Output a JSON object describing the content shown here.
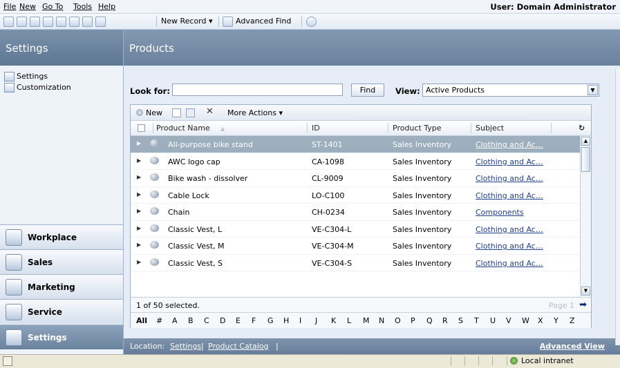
{
  "menu": {
    "items": [
      "File",
      "New",
      "Go To",
      "Tools",
      "Help"
    ],
    "user": "User: Domain Administrator"
  },
  "toolbar": {
    "new_record": "New Record ▾",
    "advanced_find": "Advanced Find"
  },
  "leftnav": {
    "title": "Settings",
    "items": [
      "Settings",
      "Customization"
    ],
    "wunderbar": [
      "Workplace",
      "Sales",
      "Marketing",
      "Service",
      "Settings"
    ]
  },
  "main": {
    "title": "Products",
    "lookfor_label": "Look for:",
    "lookfor_value": "",
    "find_label": "Find",
    "view_label": "View:",
    "view_value": "Active Products"
  },
  "grid": {
    "actions": {
      "new": "New",
      "more": "More Actions ▾"
    },
    "columns": [
      "Product Name",
      "ID",
      "Product Type",
      "Subject"
    ],
    "rows": [
      {
        "name": "All-purpose bike stand",
        "id": "ST-1401",
        "type": "Sales Inventory",
        "subject": "Clothing and Ac…",
        "selected": true
      },
      {
        "name": "AWC logo cap",
        "id": "CA-1098",
        "type": "Sales Inventory",
        "subject": "Clothing and Ac…",
        "selected": false
      },
      {
        "name": "Bike wash - dissolver",
        "id": "CL-9009",
        "type": "Sales Inventory",
        "subject": "Clothing and Ac…",
        "selected": false
      },
      {
        "name": "Cable Lock",
        "id": "LO-C100",
        "type": "Sales Inventory",
        "subject": "Clothing and Ac…",
        "selected": false
      },
      {
        "name": "Chain",
        "id": "CH-0234",
        "type": "Sales Inventory",
        "subject": "Components",
        "selected": false
      },
      {
        "name": "Classic Vest, L",
        "id": "VE-C304-L",
        "type": "Sales Inventory",
        "subject": "Clothing and Ac…",
        "selected": false
      },
      {
        "name": "Classic Vest, M",
        "id": "VE-C304-M",
        "type": "Sales Inventory",
        "subject": "Clothing and Ac…",
        "selected": false
      },
      {
        "name": "Classic Vest, S",
        "id": "VE-C304-S",
        "type": "Sales Inventory",
        "subject": "Clothing and Ac…",
        "selected": false
      }
    ],
    "selected_text": "1 of 50 selected.",
    "page_text": "Page 1",
    "alphabet": [
      "All",
      "#",
      "A",
      "B",
      "C",
      "D",
      "E",
      "F",
      "G",
      "H",
      "I",
      "J",
      "K",
      "L",
      "M",
      "N",
      "O",
      "P",
      "Q",
      "R",
      "S",
      "T",
      "U",
      "V",
      "W",
      "X",
      "Y",
      "Z"
    ]
  },
  "location": {
    "label": "Location:",
    "crumbs": [
      "Settings",
      "Product Catalog"
    ],
    "advanced_view": "Advanced View"
  },
  "status": {
    "zone": "Local intranet"
  }
}
